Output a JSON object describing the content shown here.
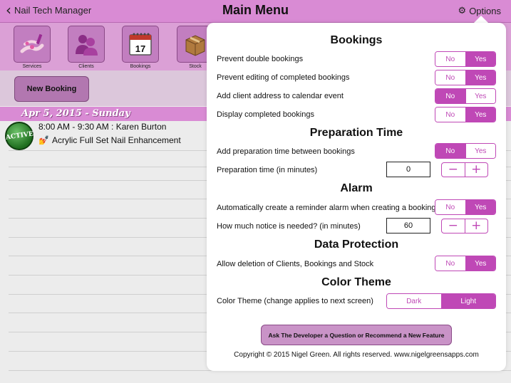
{
  "navbar": {
    "back_label": "Nail Tech Manager",
    "title": "Main Menu",
    "options_label": "Options"
  },
  "toolbar": {
    "tiles": [
      {
        "label": "Services",
        "icon": "nail-polish-icon"
      },
      {
        "label": "Clients",
        "icon": "clients-icon"
      },
      {
        "label": "Bookings",
        "icon": "calendar-icon",
        "day": "17"
      },
      {
        "label": "Stock",
        "icon": "box-icon"
      }
    ]
  },
  "main": {
    "new_booking_label": "New Booking",
    "date_header": "Apr 5, 2015 - Sunday",
    "appointment": {
      "status": "ACTIVE",
      "time_client": "8:00 AM - 9:30 AM : Karen Burton",
      "service": "Acrylic Full Set Nail Enhancement"
    }
  },
  "options": {
    "bookings_title": "Bookings",
    "prevent_double": {
      "label": "Prevent double bookings",
      "no": "No",
      "yes": "Yes",
      "selected": "Yes"
    },
    "prevent_editing": {
      "label": "Prevent editing of completed bookings",
      "no": "No",
      "yes": "Yes",
      "selected": "Yes"
    },
    "add_address": {
      "label": "Add client address to calendar event",
      "no": "No",
      "yes": "Yes",
      "selected": "No"
    },
    "display_completed": {
      "label": "Display completed bookings",
      "no": "No",
      "yes": "Yes",
      "selected": "Yes"
    },
    "prep_title": "Preparation Time",
    "add_prep": {
      "label": "Add preparation time between bookings",
      "no": "No",
      "yes": "Yes",
      "selected": "No"
    },
    "prep_minutes": {
      "label": "Preparation time (in minutes)",
      "value": "0",
      "minus": "−",
      "plus": "+"
    },
    "alarm_title": "Alarm",
    "auto_alarm": {
      "label": "Automatically create a reminder alarm when creating a booking",
      "no": "No",
      "yes": "Yes",
      "selected": "Yes"
    },
    "notice_minutes": {
      "label": "How much notice is needed? (in minutes)",
      "value": "60",
      "minus": "−",
      "plus": "+"
    },
    "data_title": "Data Protection",
    "allow_deletion": {
      "label": "Allow deletion of Clients, Bookings and Stock",
      "no": "No",
      "yes": "Yes",
      "selected": "Yes"
    },
    "color_title": "Color Theme",
    "color_theme": {
      "label": "Color Theme (change applies to next screen)",
      "dark": "Dark",
      "light": "Light",
      "selected": "Light"
    },
    "ask_button": "Ask The Developer a Question or Recommend a New Feature",
    "copyright": "Copyright © 2015 Nigel Green. All rights reserved. www.nigelgreensapps.com"
  },
  "colors": {
    "accent": "#bf48b6",
    "navbar": "#d98bd4"
  }
}
